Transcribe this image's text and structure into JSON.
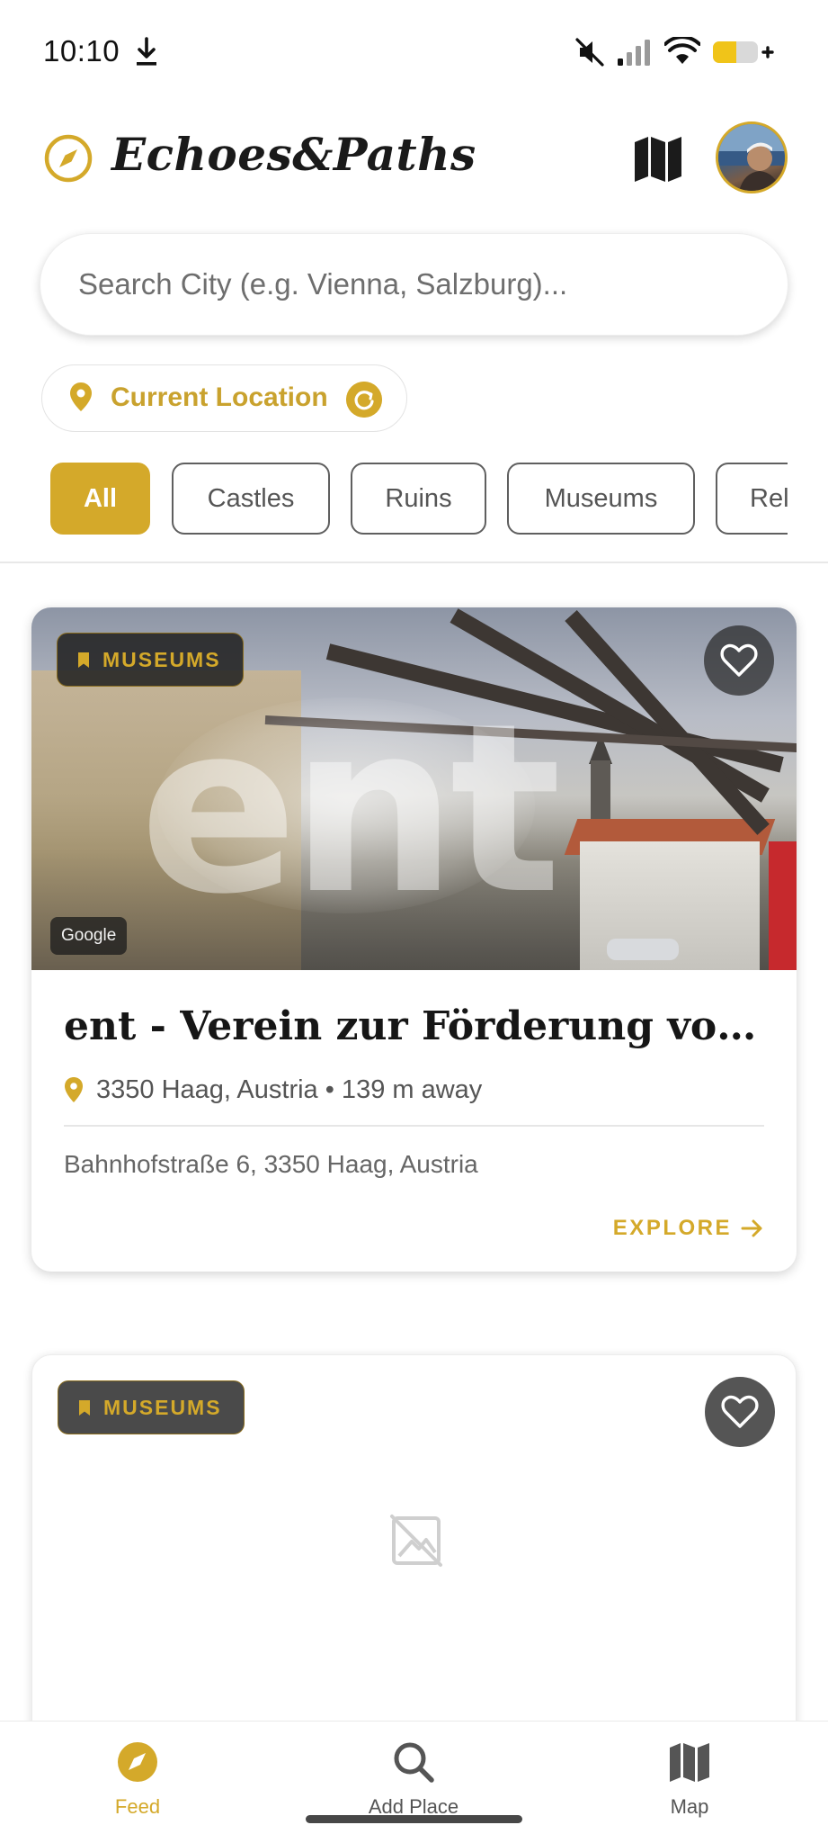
{
  "status_bar": {
    "time": "10:10",
    "icons": [
      "download-icon",
      "mute-icon",
      "signal-icon",
      "wifi-icon",
      "battery-charging-icon"
    ]
  },
  "header": {
    "app_title": "Echoes&Paths",
    "logo_icon": "compass-icon",
    "map_icon": "map-icon",
    "avatar": "user-avatar"
  },
  "search": {
    "placeholder": "Search City (e.g. Vienna, Salzburg)...",
    "value": ""
  },
  "location": {
    "label": "Current Location",
    "pin_icon": "location-pin-icon",
    "refresh_icon": "refresh-icon"
  },
  "filters": {
    "selected": "All",
    "chips": [
      "All",
      "Castles",
      "Ruins",
      "Museums",
      "Rel"
    ]
  },
  "cards": [
    {
      "category": "MUSEUMS",
      "image_attribution": "Google",
      "title": "ent - Verein zur Förderung von ...",
      "location": "3350 Haag, Austria • 139 m away",
      "address": "Bahnhofstraße 6, 3350 Haag, Austria",
      "action": "EXPLORE",
      "favorited": false
    },
    {
      "category": "MUSEUMS",
      "favorited": false,
      "image": "no-image-icon"
    }
  ],
  "bottom_nav": [
    {
      "label": "Feed",
      "icon": "compass-icon",
      "active": true
    },
    {
      "label": "Add Place",
      "icon": "search-icon",
      "active": false
    },
    {
      "label": "Map",
      "icon": "map-icon",
      "active": false
    }
  ],
  "colors": {
    "accent": "#d4a92a",
    "text": "#161616",
    "muted": "#555555"
  }
}
